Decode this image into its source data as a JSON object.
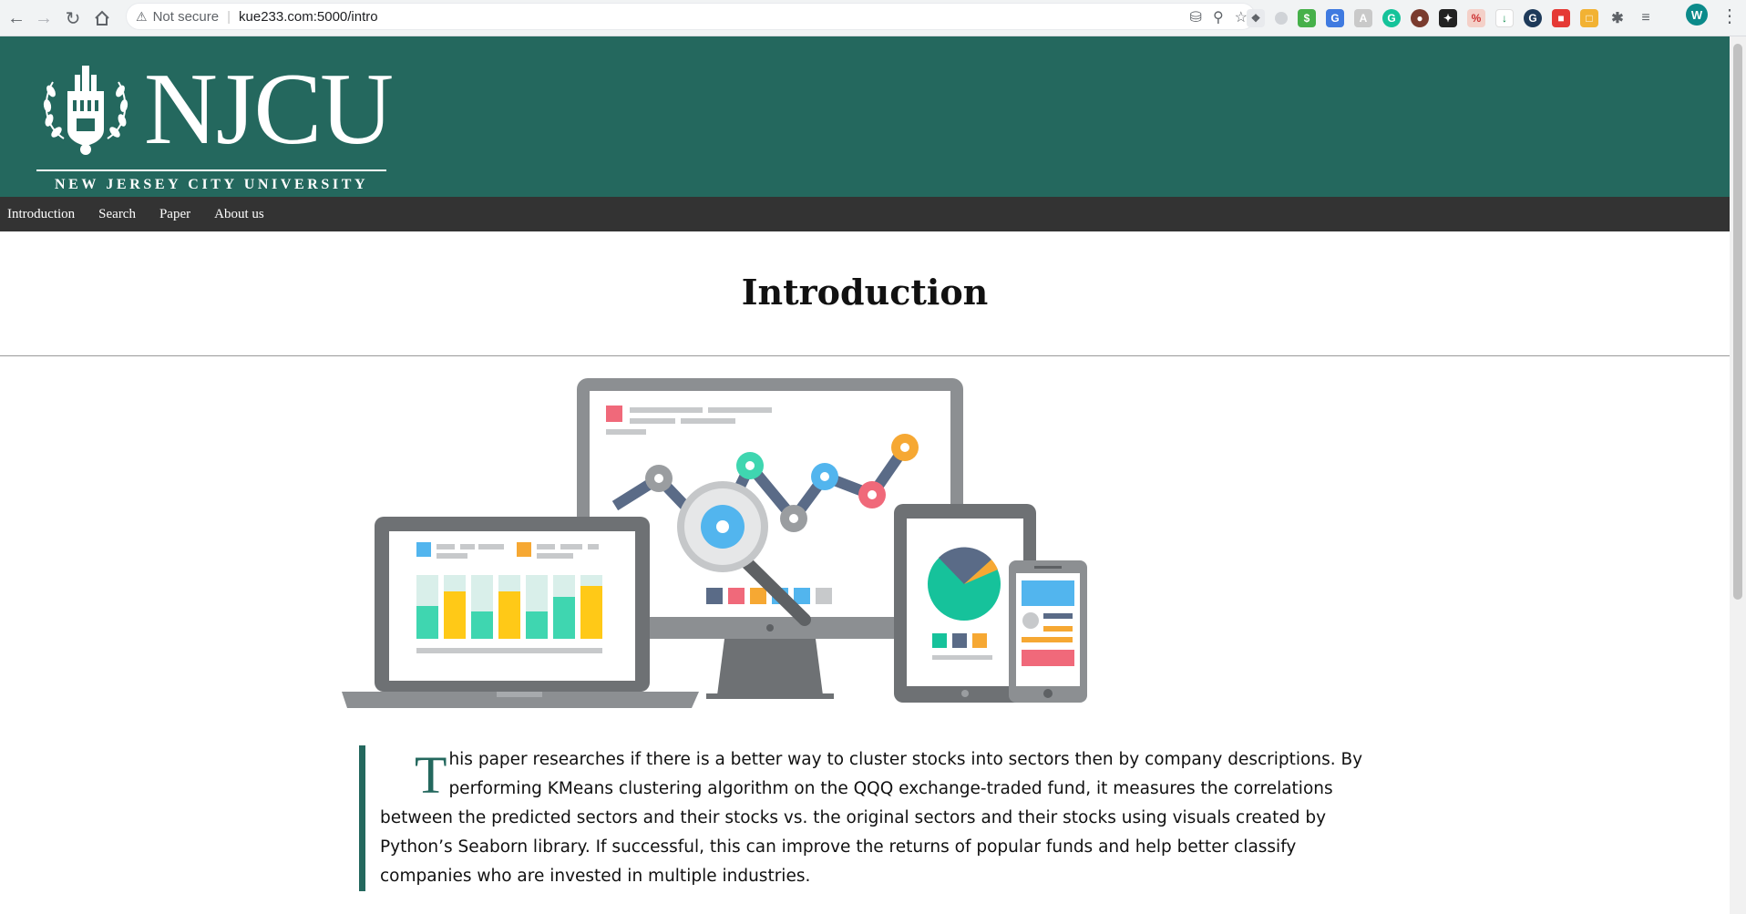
{
  "browser": {
    "url": "kue233.com:5000/intro",
    "security_label": "Not secure",
    "profile_initial": "W"
  },
  "header": {
    "logo_wordmark": "NJCU",
    "logo_subtitle": "NEW JERSEY CITY UNIVERSITY",
    "brand_color": "#24685e"
  },
  "nav": {
    "items": [
      {
        "label": "Introduction"
      },
      {
        "label": "Search"
      },
      {
        "label": "Paper"
      },
      {
        "label": "About us"
      }
    ]
  },
  "main": {
    "title": "Introduction",
    "drop_cap": "T",
    "paragraph": "his paper researches if there is a better way to cluster stocks into sectors then by company descriptions. By performing KMeans clustering algorithm on the QQQ exchange-traded fund, it measures the correlations between the predicted sectors and their stocks vs. the original sectors and their stocks using visuals created by Python’s Seaborn library. If successful, this can improve the returns of popular funds and help better classify companies who are invested in multiple industries."
  }
}
